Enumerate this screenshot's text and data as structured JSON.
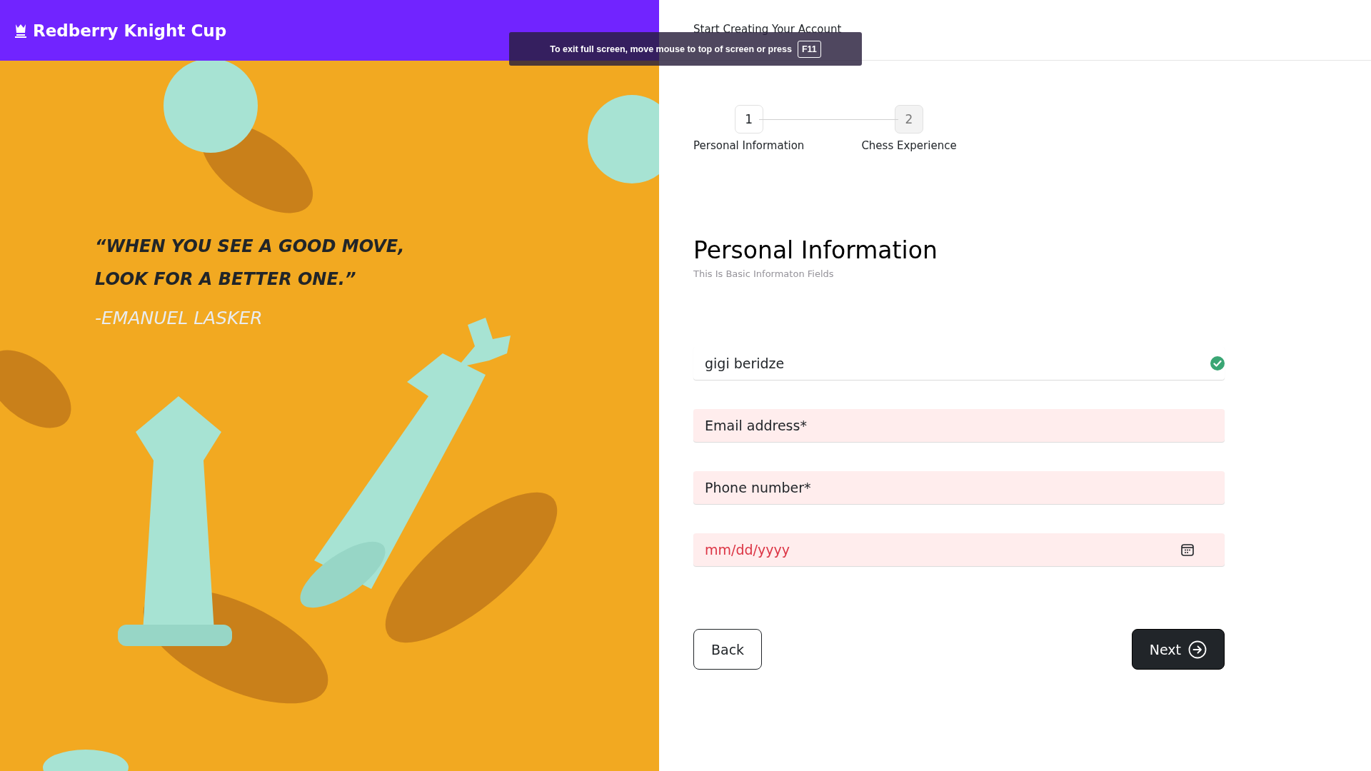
{
  "header": {
    "title": "Redberry Knight Cup"
  },
  "quote": {
    "lines": [
      "“WHEN YOU SEE A GOOD MOVE,",
      "LOOK FOR A BETTER ONE.”"
    ],
    "author": "-EMANUEL LASKER"
  },
  "top_bar": {
    "title": "Start Creating Your Account"
  },
  "steps": [
    {
      "number": "1",
      "label": "Personal Information",
      "selected": true
    },
    {
      "number": "2",
      "label": "Chess Experience",
      "selected": false
    }
  ],
  "form": {
    "title": "Personal Information",
    "subtitle": "This Is Basic Informaton Fields",
    "fields": [
      {
        "kind": "text",
        "value": "gigi beridze",
        "valid": true
      },
      {
        "kind": "text",
        "placeholder": "Email address*",
        "valid": false
      },
      {
        "kind": "text",
        "placeholder": "Phone number*",
        "valid": false
      },
      {
        "kind": "date",
        "placeholder": "mm/dd/yyyy",
        "valid": false
      }
    ]
  },
  "buttons": [
    {
      "label": "Back",
      "kind": "secondary"
    },
    {
      "label": "Next",
      "kind": "primary"
    }
  ],
  "toast": {
    "text": "To exit full screen, move mouse to top of screen or press",
    "key": "F11"
  }
}
